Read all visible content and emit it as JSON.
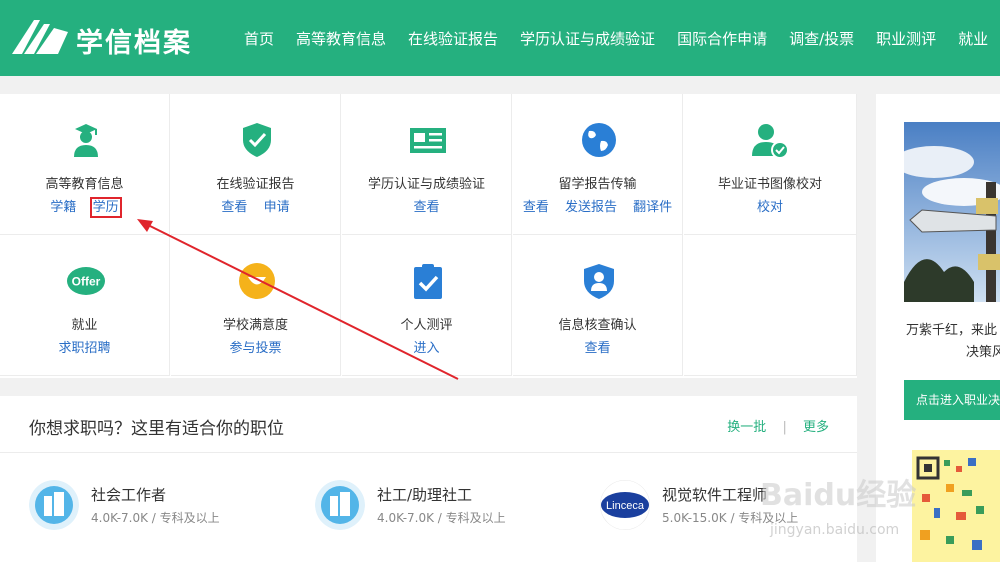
{
  "header": {
    "brand": "学信档案",
    "nav": [
      "首页",
      "高等教育信息",
      "在线验证报告",
      "学历认证与成绩验证",
      "国际合作申请",
      "调查/投票",
      "职业测评",
      "就业"
    ]
  },
  "services": [
    {
      "title": "高等教育信息",
      "icon": "graduate-icon",
      "links": [
        "学籍",
        "学历"
      ]
    },
    {
      "title": "在线验证报告",
      "icon": "shield-check-icon",
      "links": [
        "查看",
        "申请"
      ]
    },
    {
      "title": "学历认证与成绩验证",
      "icon": "id-card-icon",
      "links": [
        "查看"
      ]
    },
    {
      "title": "留学报告传输",
      "icon": "globe-icon",
      "links": [
        "查看",
        "发送报告",
        "翻译件"
      ]
    },
    {
      "title": "毕业证书图像校对",
      "icon": "user-check-icon",
      "links": [
        "校对"
      ]
    },
    {
      "title": "就业",
      "icon": "offer-icon",
      "icon_text": "Offer",
      "links": [
        "求职招聘"
      ]
    },
    {
      "title": "学校满意度",
      "icon": "smile-icon",
      "links": [
        "参与投票"
      ]
    },
    {
      "title": "个人测评",
      "icon": "clipboard-check-icon",
      "links": [
        "进入"
      ]
    },
    {
      "title": "信息核查确认",
      "icon": "user-shield-icon",
      "links": [
        "查看"
      ]
    }
  ],
  "jobs": {
    "heading": "你想求职吗？这里有适合你的职位",
    "refresh": "换一批",
    "more": "更多",
    "items": [
      {
        "title": "社会工作者",
        "salary": "4.0K-7.0K",
        "education": "专科及以上"
      },
      {
        "title": "社工/助理社工",
        "salary": "4.0K-7.0K",
        "education": "专科及以上"
      },
      {
        "title": "视觉软件工程师",
        "salary": "5.0K-15.0K",
        "education": "专科及以上",
        "logo_text": "Linceca"
      }
    ]
  },
  "sidebar": {
    "caption_line1": "万紫千红，来此",
    "caption_line2": "决策风",
    "button": "点击进入职业决"
  },
  "watermark": {
    "brand": "Baidu经验",
    "url": "jingyan.baidu.com"
  },
  "colors": {
    "brand_green": "#25b07f",
    "link_blue": "#2a6ec6",
    "highlight_red": "#e0252c"
  },
  "annotation": {
    "highlighted_link": "学历"
  }
}
